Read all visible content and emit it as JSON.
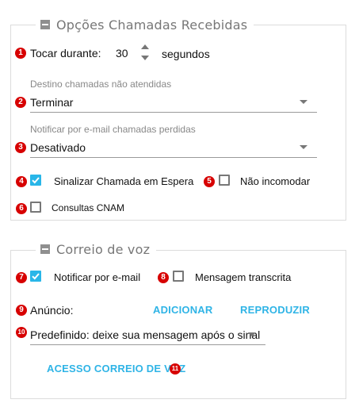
{
  "received_calls": {
    "title": "Opções Chamadas Recebidas",
    "ring_duration": {
      "label": "Tocar durante:",
      "value": "30",
      "unit": "segundos"
    },
    "unanswered_destination": {
      "label": "Destino chamadas não atendidas",
      "value": "Terminar"
    },
    "missed_email": {
      "label": "Notificar por e-mail chamadas perdidas",
      "value": "Desativado"
    },
    "call_waiting": {
      "label": "Sinalizar Chamada em Espera",
      "checked": true
    },
    "dnd": {
      "label": "Não incomodar",
      "checked": false
    },
    "cnam": {
      "label": "Consultas CNAM",
      "checked": false
    }
  },
  "voicemail": {
    "title": "Correio de voz",
    "email_notify": {
      "label": "Notificar por e-mail",
      "checked": true
    },
    "transcribe": {
      "label": "Mensagem transcrita",
      "checked": false
    },
    "announcement": {
      "label": "Anúncio:",
      "add_label": "ADICIONAR",
      "play_label": "REPRODUZIR"
    },
    "default_message": {
      "value": "Predefinido: deixe sua mensagem após o sinal"
    },
    "access_label": "ACESSO CORREIO DE VOZ"
  },
  "badges": [
    "1",
    "2",
    "3",
    "4",
    "5",
    "6",
    "7",
    "8",
    "9",
    "10",
    "11"
  ],
  "colors": {
    "accent": "#2fb4e6",
    "badge": "#d70000",
    "checkbox_checked": "#29b6e8"
  }
}
